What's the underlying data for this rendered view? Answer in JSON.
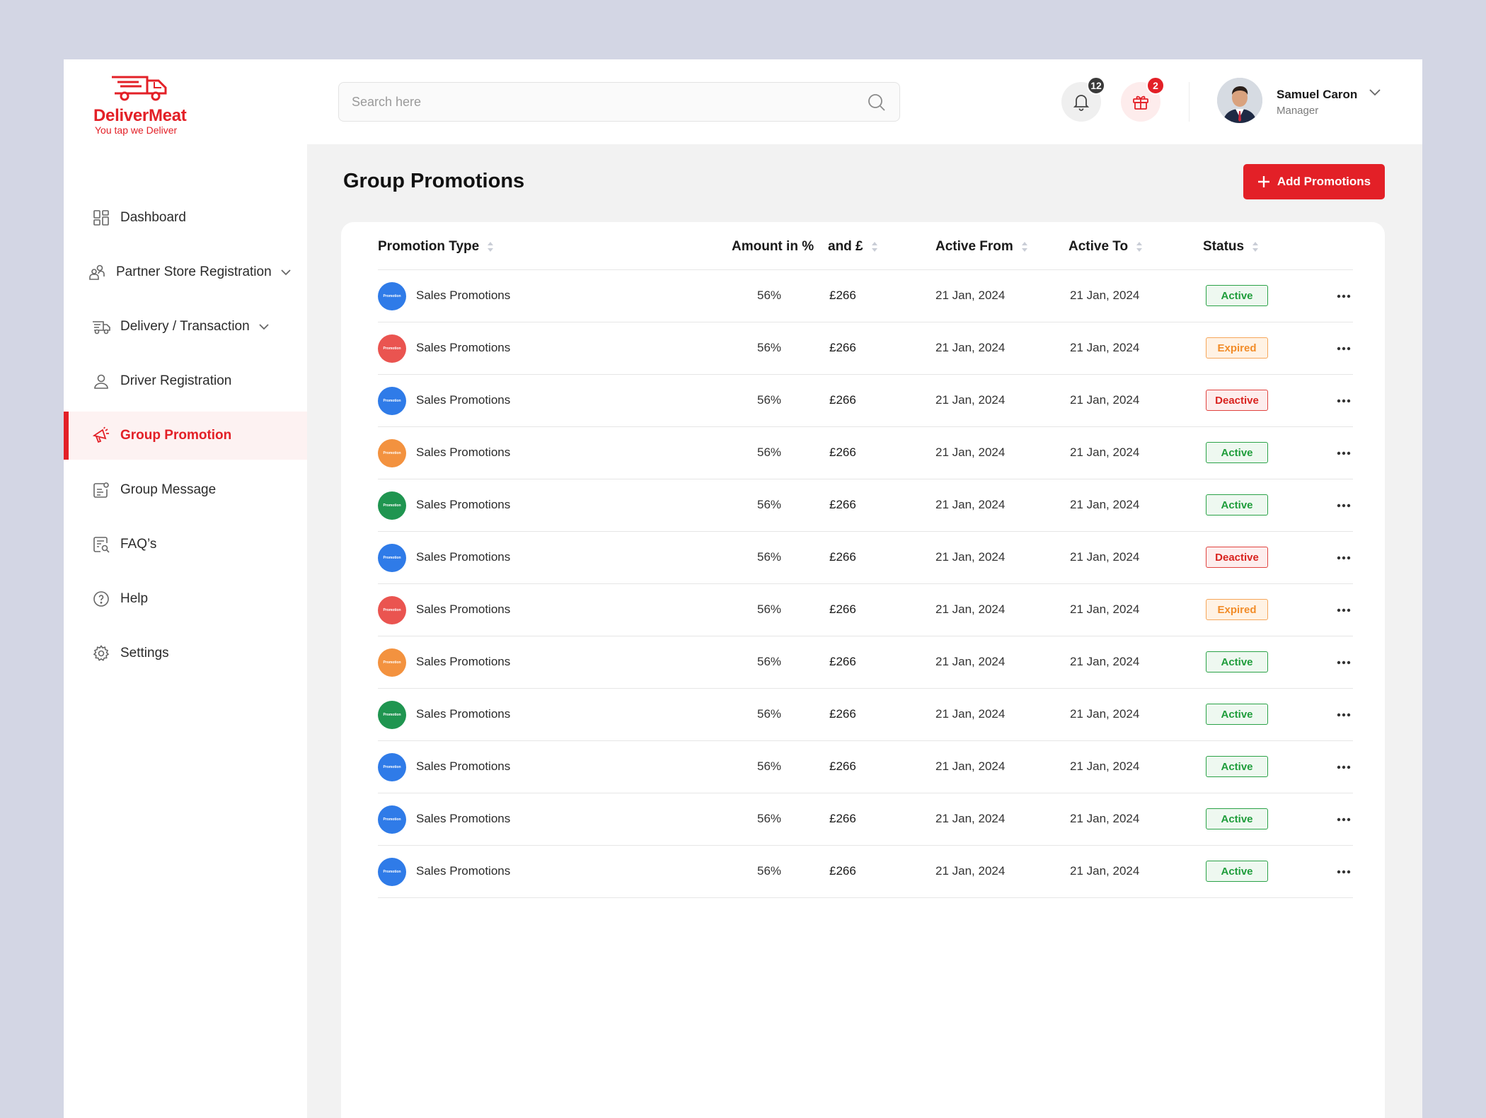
{
  "app": {
    "brand": "DeliverMeat",
    "tagline": "You tap we Deliver",
    "brand_color": "#e32027"
  },
  "sidebar": {
    "items": [
      {
        "label": "Dashboard",
        "icon": "dashboard-icon",
        "active": false,
        "has_chevron": false
      },
      {
        "label": "Partner Store Registration",
        "icon": "partner-store-icon",
        "active": false,
        "has_chevron": true
      },
      {
        "label": "Delivery / Transaction",
        "icon": "delivery-truck-icon",
        "active": false,
        "has_chevron": true
      },
      {
        "label": "Driver Registration",
        "icon": "user-icon",
        "active": false,
        "has_chevron": false
      },
      {
        "label": "Group Promotion",
        "icon": "megaphone-icon",
        "active": true,
        "has_chevron": false
      },
      {
        "label": "Group Message",
        "icon": "message-icon",
        "active": false,
        "has_chevron": false
      },
      {
        "label": "FAQ’s",
        "icon": "faq-icon",
        "active": false,
        "has_chevron": false
      },
      {
        "label": "Help",
        "icon": "help-icon",
        "active": false,
        "has_chevron": false
      },
      {
        "label": "Settings",
        "icon": "gear-icon",
        "active": false,
        "has_chevron": false
      }
    ]
  },
  "header": {
    "search_placeholder": "Search here",
    "notifications_count": "12",
    "gifts_count": "2",
    "user_name": "Samuel Caron",
    "user_role": "Manager"
  },
  "main": {
    "title": "Group Promotions",
    "add_button_label": "Add Promotions",
    "columns": [
      "Promotion Type",
      "Amount in %",
      "and £",
      "Active From",
      "Active To",
      "Status"
    ],
    "rows": [
      {
        "icon_label": "Promotion",
        "icon_color": "#2f7be8",
        "type": "Sales Promotions",
        "amount_pct": "56%",
        "amount_gbp": "£266",
        "from": "21 Jan, 2024",
        "to": "21 Jan, 2024",
        "status": "Active",
        "status_kind": "active"
      },
      {
        "icon_label": "Promotion",
        "icon_color": "#ea5450",
        "type": "Sales Promotions",
        "amount_pct": "56%",
        "amount_gbp": "£266",
        "from": "21 Jan, 2024",
        "to": "21 Jan, 2024",
        "status": "Expired",
        "status_kind": "expired"
      },
      {
        "icon_label": "Promotion",
        "icon_color": "#2f7be8",
        "type": "Sales Promotions",
        "amount_pct": "56%",
        "amount_gbp": "£266",
        "from": "21 Jan, 2024",
        "to": "21 Jan, 2024",
        "status": "Deactive",
        "status_kind": "deactive"
      },
      {
        "icon_label": "Promotion",
        "icon_color": "#f3923f",
        "type": "Sales Promotions",
        "amount_pct": "56%",
        "amount_gbp": "£266",
        "from": "21 Jan, 2024",
        "to": "21 Jan, 2024",
        "status": "Active",
        "status_kind": "active"
      },
      {
        "icon_label": "Promotion",
        "icon_color": "#1f9550",
        "type": "Sales Promotions",
        "amount_pct": "56%",
        "amount_gbp": "£266",
        "from": "21 Jan, 2024",
        "to": "21 Jan, 2024",
        "status": "Active",
        "status_kind": "active"
      },
      {
        "icon_label": "Promotion",
        "icon_color": "#2f7be8",
        "type": "Sales Promotions",
        "amount_pct": "56%",
        "amount_gbp": "£266",
        "from": "21 Jan, 2024",
        "to": "21 Jan, 2024",
        "status": "Deactive",
        "status_kind": "deactive"
      },
      {
        "icon_label": "Promotion",
        "icon_color": "#ea5450",
        "type": "Sales Promotions",
        "amount_pct": "56%",
        "amount_gbp": "£266",
        "from": "21 Jan, 2024",
        "to": "21 Jan, 2024",
        "status": "Expired",
        "status_kind": "expired"
      },
      {
        "icon_label": "Promotion",
        "icon_color": "#f3923f",
        "type": "Sales Promotions",
        "amount_pct": "56%",
        "amount_gbp": "£266",
        "from": "21 Jan, 2024",
        "to": "21 Jan, 2024",
        "status": "Active",
        "status_kind": "active"
      },
      {
        "icon_label": "Promotion",
        "icon_color": "#1f9550",
        "type": "Sales Promotions",
        "amount_pct": "56%",
        "amount_gbp": "£266",
        "from": "21 Jan, 2024",
        "to": "21 Jan, 2024",
        "status": "Active",
        "status_kind": "active"
      },
      {
        "icon_label": "Promotion",
        "icon_color": "#2f7be8",
        "type": "Sales Promotions",
        "amount_pct": "56%",
        "amount_gbp": "£266",
        "from": "21 Jan, 2024",
        "to": "21 Jan, 2024",
        "status": "Active",
        "status_kind": "active"
      },
      {
        "icon_label": "Promotion",
        "icon_color": "#2f7be8",
        "type": "Sales Promotions",
        "amount_pct": "56%",
        "amount_gbp": "£266",
        "from": "21 Jan, 2024",
        "to": "21 Jan, 2024",
        "status": "Active",
        "status_kind": "active"
      },
      {
        "icon_label": "Promotion",
        "icon_color": "#2f7be8",
        "type": "Sales Promotions",
        "amount_pct": "56%",
        "amount_gbp": "£266",
        "from": "21 Jan, 2024",
        "to": "21 Jan, 2024",
        "status": "Active",
        "status_kind": "active"
      }
    ]
  }
}
